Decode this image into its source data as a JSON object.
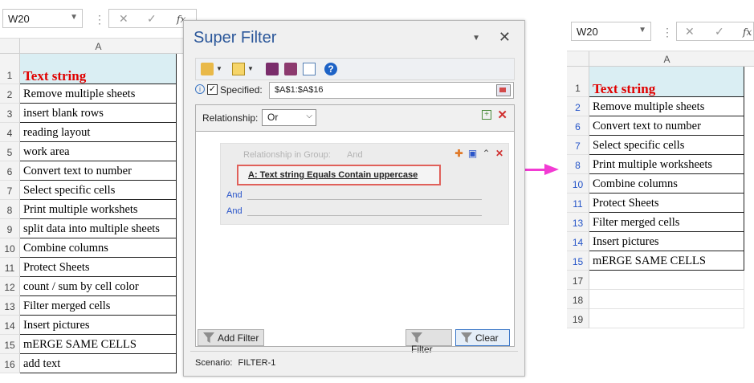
{
  "left_sheet": {
    "name_box": "W20",
    "column_header": "A",
    "rows": [
      {
        "num": "1",
        "text": "Text string",
        "header": true
      },
      {
        "num": "2",
        "text": "Remove multiple sheets"
      },
      {
        "num": "3",
        "text": "insert blank rows"
      },
      {
        "num": "4",
        "text": "reading layout"
      },
      {
        "num": "5",
        "text": "work area"
      },
      {
        "num": "6",
        "text": "Convert text to number"
      },
      {
        "num": "7",
        "text": "Select specific cells"
      },
      {
        "num": "8",
        "text": "Print multiple workshets"
      },
      {
        "num": "9",
        "text": "split data into multiple sheets"
      },
      {
        "num": "10",
        "text": "Combine columns"
      },
      {
        "num": "11",
        "text": "Protect Sheets"
      },
      {
        "num": "12",
        "text": "count / sum by cell color"
      },
      {
        "num": "13",
        "text": "Filter merged cells"
      },
      {
        "num": "14",
        "text": "Insert pictures"
      },
      {
        "num": "15",
        "text": "mERGE SAME CELLS"
      },
      {
        "num": "16",
        "text": "add text"
      }
    ]
  },
  "right_sheet": {
    "name_box": "W20",
    "column_header": "A",
    "rows": [
      {
        "num": "1",
        "text": "Text string",
        "header": true
      },
      {
        "num": "2",
        "text": "Remove multiple sheets",
        "blue": true
      },
      {
        "num": "6",
        "text": "Convert text to number",
        "blue": true
      },
      {
        "num": "7",
        "text": "Select specific cells",
        "blue": true
      },
      {
        "num": "8",
        "text": "Print multiple worksheets",
        "blue": true
      },
      {
        "num": "10",
        "text": "Combine columns",
        "blue": true
      },
      {
        "num": "11",
        "text": "Protect Sheets",
        "blue": true
      },
      {
        "num": "13",
        "text": "Filter merged cells",
        "blue": true
      },
      {
        "num": "14",
        "text": "Insert pictures",
        "blue": true
      },
      {
        "num": "15",
        "text": "mERGE SAME CELLS",
        "blue": true
      },
      {
        "num": "17",
        "text": ""
      },
      {
        "num": "18",
        "text": ""
      },
      {
        "num": "19",
        "text": ""
      }
    ]
  },
  "dialog": {
    "title": "Super Filter",
    "specified_label": "Specified:",
    "specified_checked": true,
    "range": "$A$1:$A$16",
    "relationship_label": "Relationship:",
    "relationship_value": "Or",
    "group_label": "Relationship in Group:",
    "group_value": "And",
    "condition": "A: Text string  Equals  Contain uppercase",
    "and_rows": [
      "And",
      "And"
    ],
    "add_filter_label": "Add Filter",
    "filter_label": "Filter",
    "clear_label": "Clear",
    "scenario_label": "Scenario:",
    "scenario_value": "FILTER-1"
  },
  "colors": {
    "header_fill": "#daeef3",
    "header_text": "#e00000",
    "arrow": "#f23bd3",
    "condition_border": "#e0605a",
    "title_blue": "#2b579a",
    "row_blue": "#2454c8"
  }
}
